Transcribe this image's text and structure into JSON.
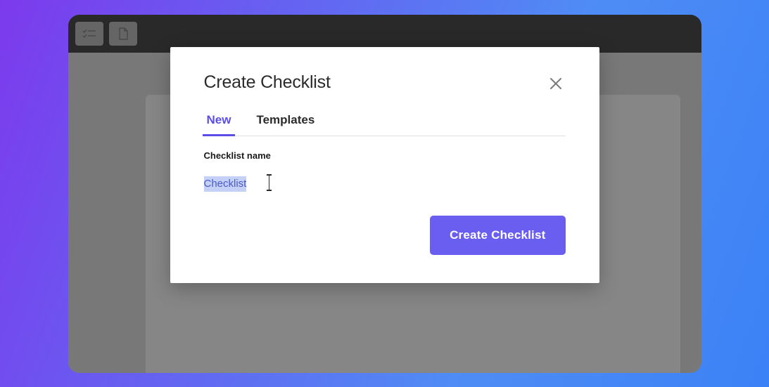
{
  "modal": {
    "title": "Create Checklist",
    "tabs": {
      "new": "New",
      "templates": "Templates"
    },
    "field_label": "Checklist name",
    "input_value": "Checklist",
    "submit_label": "Create Checklist"
  },
  "colors": {
    "accent": "#6a5ef0",
    "tab_active": "#5b4ee8",
    "selection_bg": "#c4d0f5",
    "selection_fg": "#4a5bc7"
  }
}
